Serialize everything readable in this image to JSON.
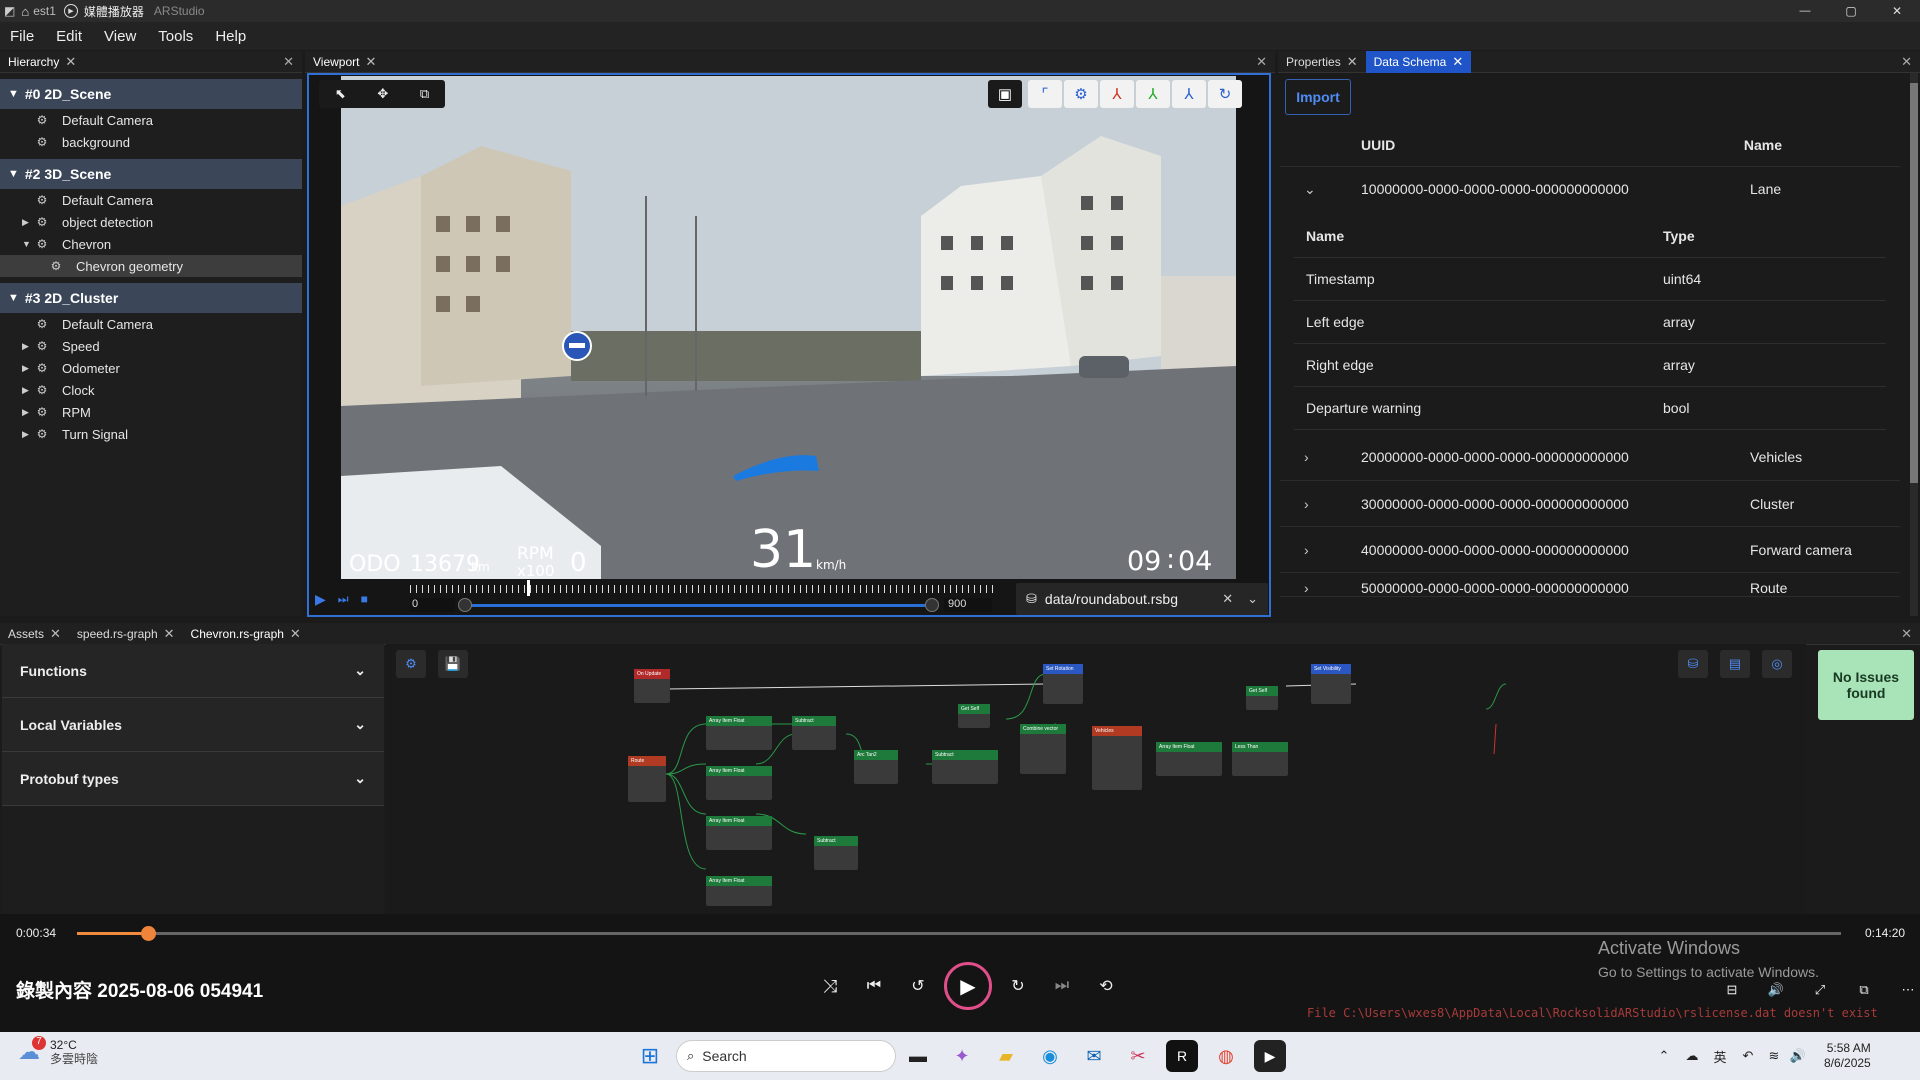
{
  "window": {
    "title": "媒體播放器",
    "title_fragment_left": "est1",
    "title_fragment_right": "ARStudio",
    "min": "—",
    "max": "▢",
    "close": "✕"
  },
  "menu": [
    "File",
    "Edit",
    "View",
    "Tools",
    "Help"
  ],
  "hierarchy": {
    "tab": "Hierarchy",
    "scenes": [
      {
        "label": "#0 2D_Scene",
        "items": [
          {
            "label": "Default Camera",
            "arrow": ""
          },
          {
            "label": "background",
            "arrow": ""
          }
        ]
      },
      {
        "label": "#2 3D_Scene",
        "items": [
          {
            "label": "Default Camera",
            "arrow": ""
          },
          {
            "label": "object detection",
            "arrow": "▶"
          },
          {
            "label": "Chevron",
            "arrow": "▼"
          },
          {
            "label": "Chevron geometry",
            "arrow": "",
            "child": true
          }
        ]
      },
      {
        "label": "#3 2D_Cluster",
        "items": [
          {
            "label": "Default Camera",
            "arrow": ""
          },
          {
            "label": "Speed",
            "arrow": "▶"
          },
          {
            "label": "Odometer",
            "arrow": "▶"
          },
          {
            "label": "Clock",
            "arrow": "▶"
          },
          {
            "label": "RPM",
            "arrow": "▶"
          },
          {
            "label": "Turn Signal",
            "arrow": "▶"
          }
        ]
      }
    ]
  },
  "viewport": {
    "tab": "Viewport",
    "odo_label": "ODO",
    "odo_value": "13679",
    "odo_unit": "km",
    "rpm_label": "RPM",
    "rpm_sub": "x100",
    "rpm_value": "0",
    "speed": "31",
    "speed_unit": "km/h",
    "clock_h": "09",
    "clock_sep": ":",
    "clock_m": "04",
    "range_start": "0",
    "range_end": "900",
    "file": "data/roundabout.rsbg",
    "timeline_position": 0.2,
    "range_position": 0.95
  },
  "schema": {
    "tab_properties": "Properties",
    "tab_schema": "Data Schema",
    "import": "Import",
    "col_uuid": "UUID",
    "col_name": "Name",
    "expanded": {
      "uuid": "10000000-0000-0000-0000-000000000000",
      "name": "Lane",
      "sub_col_name": "Name",
      "sub_col_type": "Type",
      "fields": [
        {
          "name": "Timestamp",
          "type": "uint64"
        },
        {
          "name": "Left edge",
          "type": "array"
        },
        {
          "name": "Right edge",
          "type": "array"
        },
        {
          "name": "Departure warning",
          "type": "bool"
        }
      ]
    },
    "rows": [
      {
        "uuid": "20000000-0000-0000-0000-000000000000",
        "name": "Vehicles"
      },
      {
        "uuid": "30000000-0000-0000-0000-000000000000",
        "name": "Cluster"
      },
      {
        "uuid": "40000000-0000-0000-0000-000000000000",
        "name": "Forward camera"
      },
      {
        "uuid": "50000000-0000-0000-0000-000000000000",
        "name": "Route"
      }
    ]
  },
  "bottom_tabs": [
    "Assets",
    "speed.rs-graph",
    "Chevron.rs-graph"
  ],
  "accordion": [
    "Functions",
    "Local Variables",
    "Protobuf types"
  ],
  "issues": "No Issues found",
  "nodes": {
    "on_update": "On Update",
    "set_rotation": "Set Rotation",
    "set_visibility": "Set Visibility",
    "get_self": "Get Self",
    "combine": "Combine vector",
    "vehicles": "Vehicles",
    "array_item": "Array Item Float",
    "less_than": "Less Than",
    "subtract": "Subtract",
    "route": "Route",
    "atan": "Arc Tan2"
  },
  "player": {
    "elapsed": "0:00:34",
    "total": "0:14:20",
    "progress": 0.04,
    "recording": "錄製內容 2025-08-06 054941"
  },
  "activate": {
    "title": "Activate Windows",
    "sub": "Go to Settings to activate Windows."
  },
  "license_error": "File C:\\Users\\wxes8\\AppData\\Local\\RocksolidARStudio\\rslicense.dat doesn't exist",
  "taskbar": {
    "temp": "32°C",
    "weather": "多雲時陰",
    "badge": "7",
    "search": "Search",
    "ime": "英",
    "time": "5:58 AM",
    "date": "8/6/2025"
  }
}
